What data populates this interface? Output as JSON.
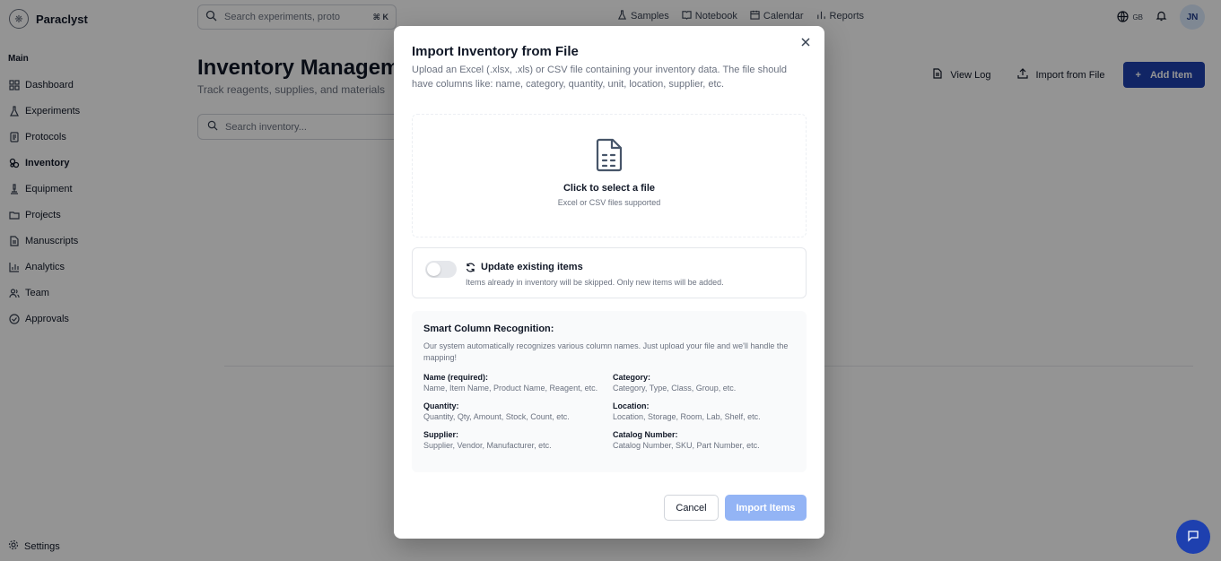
{
  "app": {
    "name": "Paraclyst"
  },
  "sidebar": {
    "section": "Main",
    "items": [
      {
        "label": "Dashboard",
        "icon": "dashboard-icon"
      },
      {
        "label": "Experiments",
        "icon": "flask-icon"
      },
      {
        "label": "Protocols",
        "icon": "document-icon"
      },
      {
        "label": "Inventory",
        "icon": "inventory-icon",
        "active": true
      },
      {
        "label": "Equipment",
        "icon": "microscope-icon"
      },
      {
        "label": "Projects",
        "icon": "folder-icon"
      },
      {
        "label": "Manuscripts",
        "icon": "file-icon"
      },
      {
        "label": "Analytics",
        "icon": "chart-icon"
      },
      {
        "label": "Team",
        "icon": "users-icon"
      },
      {
        "label": "Approvals",
        "icon": "check-circle-icon"
      }
    ],
    "settings": "Settings"
  },
  "topbar": {
    "search_placeholder": "Search experiments, proto",
    "shortcut": "⌘ K",
    "links": [
      "Samples",
      "Notebook",
      "Calendar",
      "Reports"
    ],
    "language": "GB",
    "avatar": "JN"
  },
  "page": {
    "title": "Inventory Management",
    "subtitle": "Track reagents, supplies, and materials",
    "search_placeholder": "Search inventory...",
    "actions": {
      "view_log": "View Log",
      "import": "Import from File",
      "add": "Add Item"
    }
  },
  "modal": {
    "title": "Import Inventory from File",
    "description": "Upload an Excel (.xlsx, .xls) or CSV file containing your inventory data. The file should have columns like: name, category, quantity, unit, location, supplier, etc.",
    "dropzone": {
      "title": "Click to select a file",
      "subtitle": "Excel or CSV files supported"
    },
    "update": {
      "title": "Update existing items",
      "subtitle": "Items already in inventory will be skipped. Only new items will be added.",
      "enabled": false
    },
    "smart": {
      "title": "Smart Column Recognition:",
      "description": "Our system automatically recognizes various column names. Just upload your file and we'll handle the mapping!",
      "columns": [
        {
          "name": "Name (required):",
          "aliases": "Name, Item Name, Product Name, Reagent, etc."
        },
        {
          "name": "Category:",
          "aliases": "Category, Type, Class, Group, etc."
        },
        {
          "name": "Quantity:",
          "aliases": "Quantity, Qty, Amount, Stock, Count, etc."
        },
        {
          "name": "Location:",
          "aliases": "Location, Storage, Room, Lab, Shelf, etc."
        },
        {
          "name": "Supplier:",
          "aliases": "Supplier, Vendor, Manufacturer, etc."
        },
        {
          "name": "Catalog Number:",
          "aliases": "Catalog Number, SKU, Part Number, etc."
        }
      ]
    },
    "buttons": {
      "cancel": "Cancel",
      "import": "Import Items"
    }
  },
  "colors": {
    "primary": "#1e40af",
    "import_disabled": "#93b4f5"
  }
}
